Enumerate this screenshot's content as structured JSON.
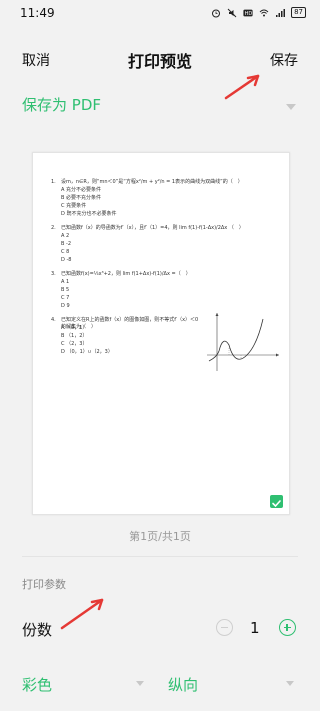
{
  "status_bar": {
    "time": "11:49",
    "battery": "87"
  },
  "header": {
    "cancel_label": "取消",
    "title": "打印预览",
    "save_label": "保存"
  },
  "printer": {
    "selected": "保存为 PDF"
  },
  "preview": {
    "questions": [
      {
        "num": "1.",
        "lines": [
          "设m，n∈R，则“mn＜0”是“方程x²/m + y²/n = 1表示的曲线为双曲线”的（　）",
          "A 充分不必要条件",
          "B 必要不充分条件",
          "C 充要条件",
          "D 既不充分也不必要条件"
        ]
      },
      {
        "num": "2.",
        "lines": [
          "已知函数f（x）的导函数为f′（x），且f′（1）=4，则 lim f(1)-f(1-Δx)/2Δx （　）",
          "A 2",
          "B -2",
          "C 8",
          "D -8"
        ]
      },
      {
        "num": "3.",
        "lines": [
          "已知函数f(x)=⅓x³+2，则 lim f(1+Δx)-f(1)/Δx =（　）",
          "A 1",
          "B 5",
          "C 7",
          "D 9"
        ]
      },
      {
        "num": "4.",
        "lines": [
          "已知定义在R上的函数f（x）的图像如图，则不等式f′（x）＜0的解集为（　）",
          "A （0，1）",
          "B （1，2）",
          "C （2，3）",
          "D （0，1）∪（2，3）"
        ]
      }
    ],
    "page_indicator": "第1页/共1页"
  },
  "params": {
    "section_label": "打印参数",
    "copies_label": "份数",
    "copies_value": "1",
    "color_mode": "彩色",
    "orientation": "纵向"
  },
  "colors": {
    "accent": "#2fbf71",
    "annotation_arrow": "#e53935"
  }
}
